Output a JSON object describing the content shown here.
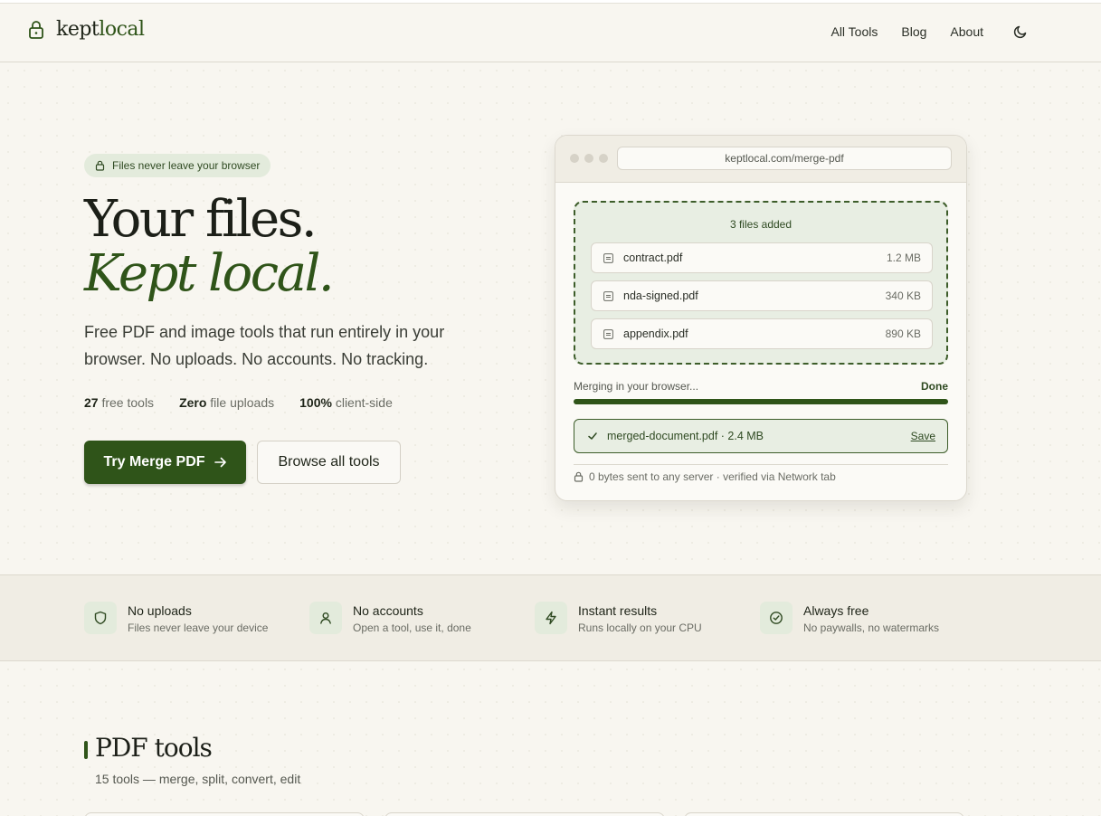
{
  "header": {
    "logo_primary": "kept",
    "logo_accent": "local",
    "nav": [
      "All Tools",
      "Blog",
      "About"
    ]
  },
  "hero": {
    "badge": "Files never leave your browser",
    "title_line1": "Your files.",
    "title_line2": "Kept local.",
    "subtitle": "Free PDF and image tools that run entirely in your browser. No uploads. No accounts. No tracking.",
    "stats": [
      {
        "value": "27",
        "label": " free tools"
      },
      {
        "value": "Zero",
        "label": " file uploads"
      },
      {
        "value": "100%",
        "label": " client-side"
      }
    ],
    "primary_button": "Try Merge PDF",
    "secondary_button": "Browse all tools"
  },
  "mockup": {
    "url": "keptlocal.com/merge-pdf",
    "drop_title": "3 files added",
    "files": [
      {
        "name": "contract.pdf",
        "size": "1.2 MB"
      },
      {
        "name": "nda-signed.pdf",
        "size": "340 KB"
      },
      {
        "name": "appendix.pdf",
        "size": "890 KB"
      }
    ],
    "merging_label": "Merging in your browser...",
    "merging_status": "Done",
    "progress": 1.0,
    "result_name": "merged-document.pdf · 2.4 MB",
    "result_action": "Save",
    "footer": "0 bytes sent to any server · verified via Network tab"
  },
  "features": [
    {
      "icon": "shield-icon",
      "title": "No uploads",
      "desc": "Files never leave your device"
    },
    {
      "icon": "user-icon",
      "title": "No accounts",
      "desc": "Open a tool, use it, done"
    },
    {
      "icon": "bolt-icon",
      "title": "Instant results",
      "desc": "Runs locally on your CPU"
    },
    {
      "icon": "check-circle-icon",
      "title": "Always free",
      "desc": "No paywalls, no watermarks"
    }
  ],
  "section": {
    "title": "PDF tools",
    "subtitle": "15 tools — merge, split, convert, edit"
  },
  "colors": {
    "accent": "#2f5419",
    "background": "#f8f6f0",
    "accent_light": "#e3ebdc"
  }
}
